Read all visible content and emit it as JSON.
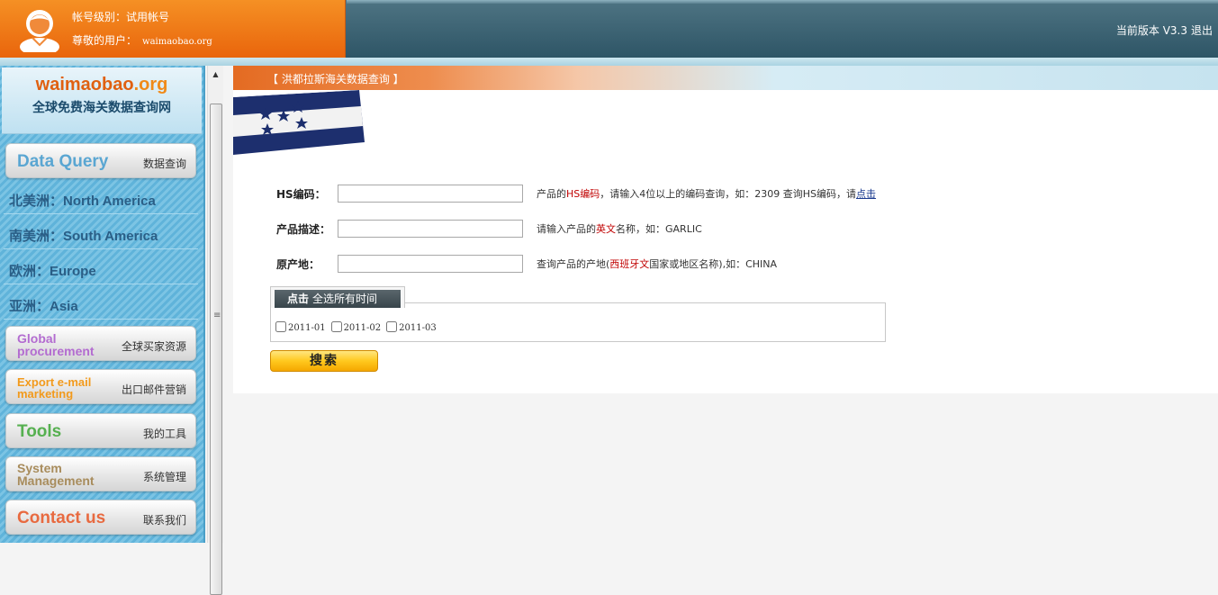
{
  "header": {
    "account_level": "帐号级别：试用帐号",
    "user_label": "尊敬的用户：",
    "user_value": "waimaobao.org",
    "version": "当前版本 V3.3",
    "logout": "退出"
  },
  "logo": {
    "name": "waimaobao",
    "tld": ".org",
    "subtitle": "全球免费海关数据查询网"
  },
  "sidebar": {
    "data_query": {
      "en": "Data Query",
      "cn": "数据查询",
      "color": "#5aa6d2"
    },
    "regions": [
      {
        "label": "北美洲：North America"
      },
      {
        "label": "南美洲：South America"
      },
      {
        "label": "欧洲：Europe"
      },
      {
        "label": "亚洲：Asia"
      }
    ],
    "global_procurement": {
      "en_line1": "Global",
      "en_line2": "procurement",
      "cn": "全球买家资源",
      "color": "#b36cd0"
    },
    "export_email": {
      "en_line1": "Export e-mail",
      "en_line2": "marketing",
      "cn": "出口邮件营销",
      "color": "#f29a1c"
    },
    "tools": {
      "en": "Tools",
      "cn": "我的工具",
      "color": "#56b050"
    },
    "system": {
      "en_line1": "System",
      "en_line2": "Management",
      "cn": "系统管理",
      "color": "#a88c5c"
    },
    "contact": {
      "en": "Contact us",
      "cn": "联系我们",
      "color": "#e86a40"
    }
  },
  "main": {
    "title": "【 洪都拉斯海关数据查询 】",
    "fields": {
      "hs": {
        "label": "HS编码：",
        "value": "",
        "hint_pre": "产品的",
        "hint_hl": "HS编码",
        "hint_mid": "，请输入4位以上的编码查询，如：2309 查询HS编码，请",
        "hint_link": "点击"
      },
      "desc": {
        "label": "产品描述：",
        "value": "",
        "hint_pre": "请输入产品的",
        "hint_hl": "英文",
        "hint_post": "名称，如：GARLIC"
      },
      "origin": {
        "label": "原产地：",
        "value": "",
        "hint_pre": "查询产品的产地(",
        "hint_hl": "西班牙文",
        "hint_post": "国家或地区名称),如：CHINA"
      }
    },
    "date_select": {
      "select_all_bold": "点击",
      "select_all_text": "全选所有时间",
      "options": [
        "2011-01",
        "2011-02",
        "2011-03"
      ]
    },
    "search_button": "搜索"
  }
}
